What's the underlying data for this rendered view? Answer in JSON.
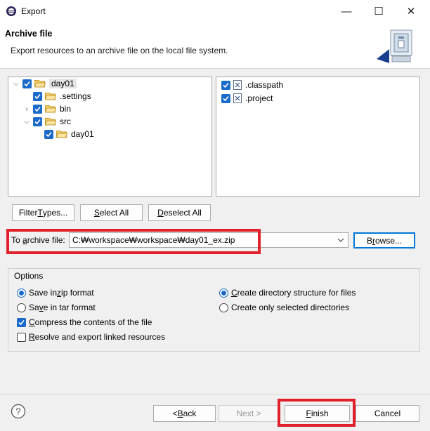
{
  "window": {
    "title": "Export",
    "minimize": "—",
    "maximize": "☐",
    "close": "✕"
  },
  "banner": {
    "title": "Archive file",
    "description": "Export resources to an archive file on the local file system."
  },
  "left_tree": [
    {
      "label": "day01",
      "checked": true,
      "expander": "down"
    },
    {
      "label": ".settings",
      "checked": true,
      "expander": ""
    },
    {
      "label": "bin",
      "checked": true,
      "expander": "right"
    },
    {
      "label": "src",
      "checked": true,
      "expander": "down"
    },
    {
      "label": "day01",
      "checked": true,
      "expander": ""
    }
  ],
  "right_list": [
    {
      "label": ".classpath",
      "checked": true
    },
    {
      "label": ".project",
      "checked": true
    }
  ],
  "selection_buttons": {
    "filter_types": {
      "pre": "Filter ",
      "key": "T",
      "post": "ypes..."
    },
    "select_all": {
      "pre": "",
      "key": "S",
      "post": "elect All"
    },
    "deselect_all": {
      "pre": "",
      "key": "D",
      "post": "eselect All"
    }
  },
  "archive": {
    "label_pre": "To ",
    "label_key": "a",
    "label_post": "rchive file:",
    "value": "C:₩workspace₩workspace₩day01_ex.zip",
    "browse_pre": "B",
    "browse_key": "r",
    "browse_post": "owse..."
  },
  "options": {
    "group_label": "Options",
    "zip": {
      "pre": "Save in ",
      "key": "z",
      "post": "ip format",
      "selected": true
    },
    "tar": {
      "pre": "Sa",
      "key": "v",
      "post": "e in tar format",
      "selected": false
    },
    "compress": {
      "pre": "",
      "key": "C",
      "post": "ompress the contents of the file",
      "checked": true
    },
    "resolve": {
      "pre": "",
      "key": "R",
      "post": "esolve and export linked resources",
      "checked": false
    },
    "create_structure": {
      "pre": "",
      "key": "C",
      "post": "reate directory structure for files",
      "selected": true
    },
    "create_selected": {
      "pre": "Create only selected directories",
      "key": "",
      "post": "",
      "selected": false
    }
  },
  "footer": {
    "help": "?",
    "back": {
      "pre": "< ",
      "key": "B",
      "post": "ack"
    },
    "next": "Next >",
    "finish": {
      "pre": "",
      "key": "F",
      "post": "inish"
    },
    "cancel": "Cancel"
  },
  "colors": {
    "accent": "#1a6ac9",
    "highlight": "#e0212b"
  }
}
